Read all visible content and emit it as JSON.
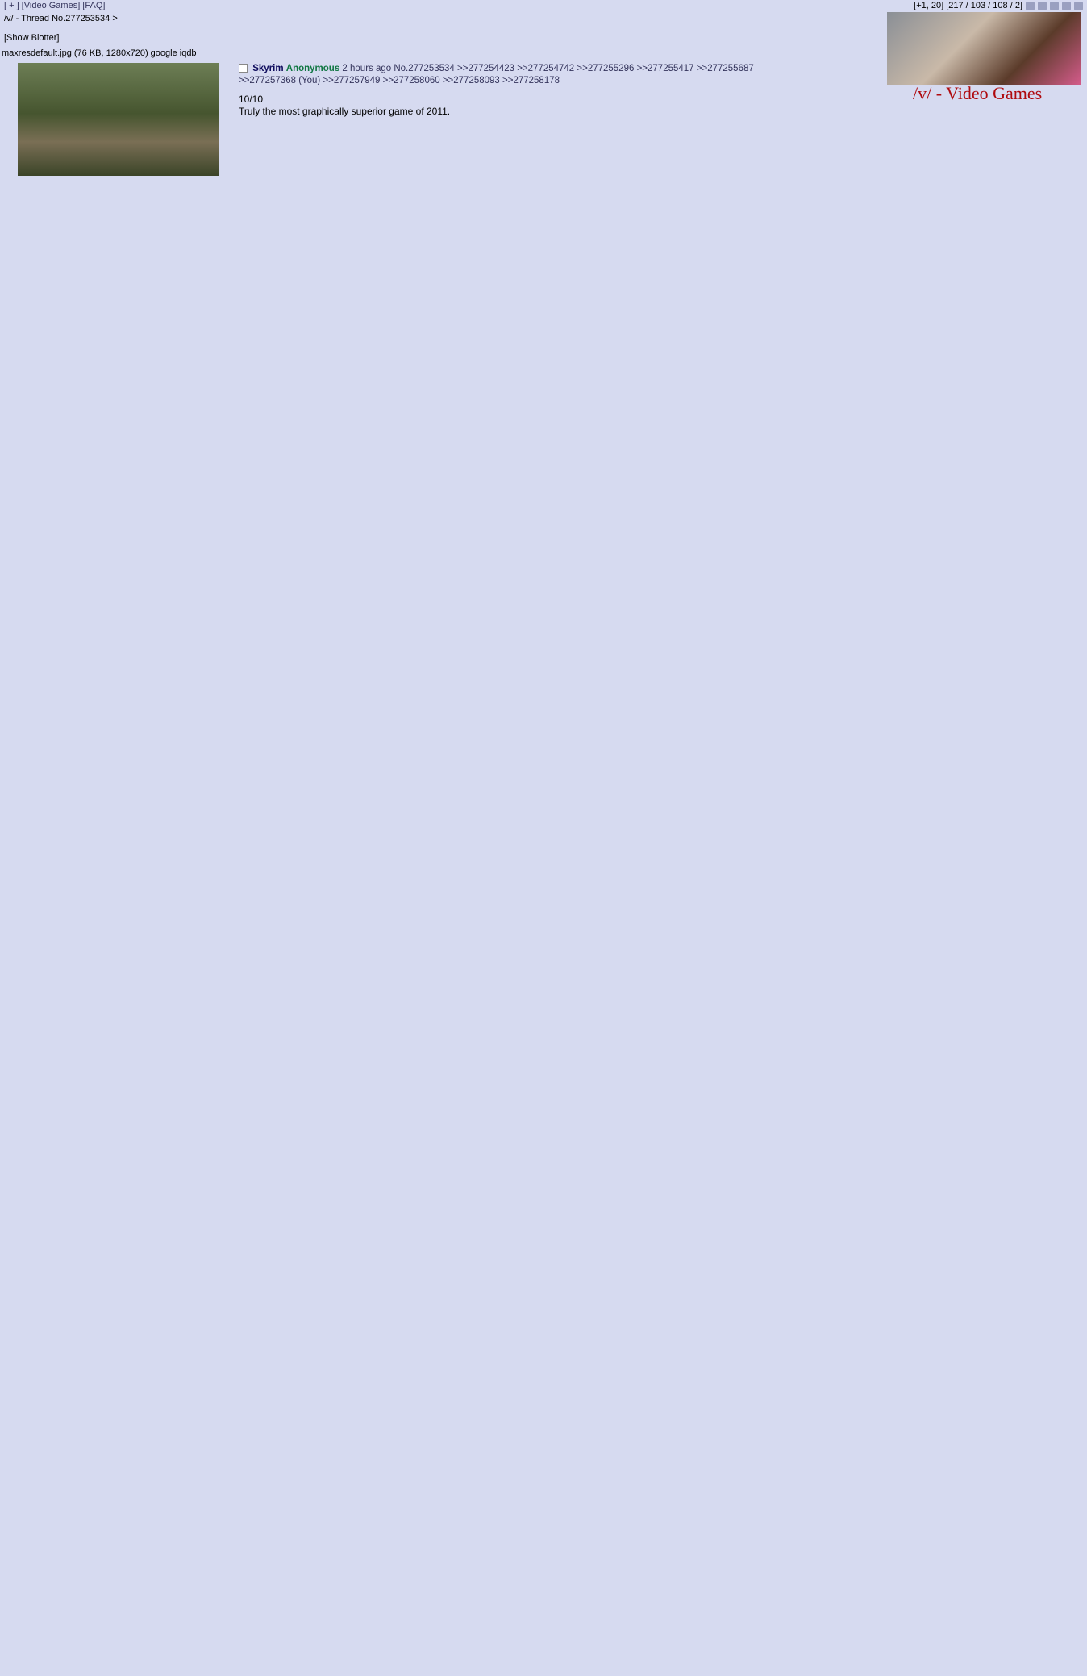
{
  "top_nav": {
    "left": "[ + ] [Video Games] [FAQ]",
    "right": "[+1, 20] [217 / 103 / 108 / 2]"
  },
  "breadcrumb": "/v/ - Thread No.277253534 >",
  "show_blotter": "[Show Blotter]",
  "banner": {
    "title": "/v/ - Video Games"
  },
  "op": {
    "file": "maxresdefault.jpg (76 KB, 1280x720) google iqdb",
    "subject": "Skyrim",
    "name": "Anonymous",
    "meta": "2 hours ago No.277253534 >>277254423 >>277254742 >>277255296 >>277255417 >>277255687",
    "meta2": ">>277257368 (You) >>277257949 >>277258060 >>277258093 >>277258178",
    "body": [
      "10/10",
      "Truly the most graphically superior game of 2011."
    ]
  }
}
